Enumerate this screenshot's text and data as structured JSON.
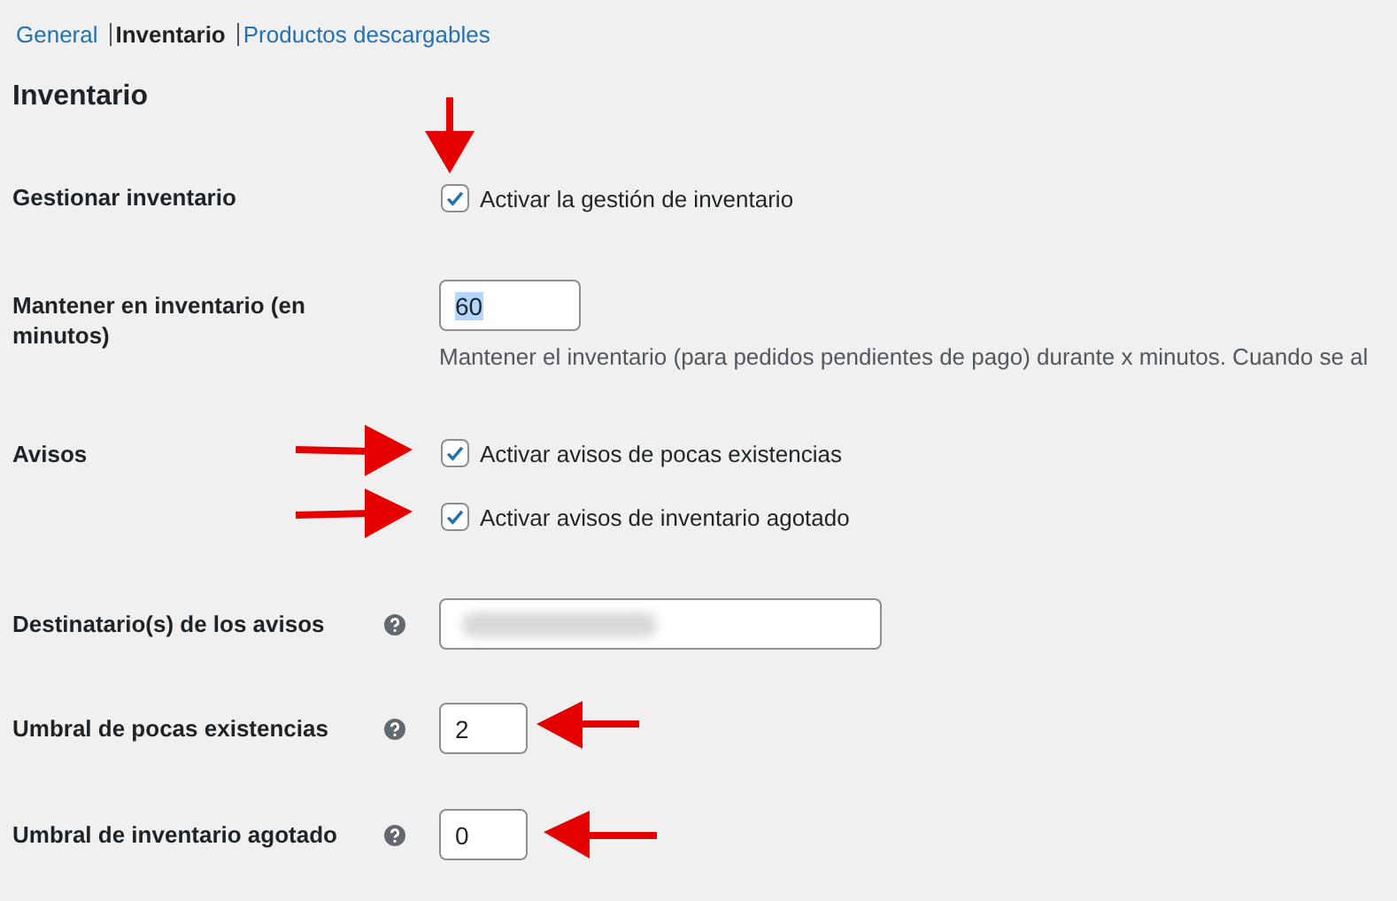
{
  "tabs": [
    {
      "label": "General",
      "selected": false
    },
    {
      "label": "Inventario",
      "selected": true
    },
    {
      "label": "Productos descargables",
      "selected": false
    }
  ],
  "heading": "Inventario",
  "rows": [
    {
      "kind": "checkboxes",
      "label": "Gestionar inventario",
      "help_tip": false,
      "options": [
        {
          "label": "Activar la gestión de inventario",
          "checked": true
        }
      ]
    },
    {
      "kind": "number",
      "label": "Mantener en inventario (en minutos)",
      "help_tip": false,
      "value": "60",
      "value_selected": true,
      "description": "Mantener el inventario (para pedidos pendientes de pago) durante x minutos. Cuando se al"
    },
    {
      "kind": "checkboxes",
      "label": "Avisos",
      "help_tip": false,
      "options": [
        {
          "label": "Activar avisos de pocas existencias",
          "checked": true
        },
        {
          "label": "Activar avisos de inventario agotado",
          "checked": true
        }
      ]
    },
    {
      "kind": "text",
      "label": "Destinatario(s) de los avisos",
      "help_tip": true,
      "blurred": true
    },
    {
      "kind": "number",
      "label": "Umbral de pocas existencias",
      "help_tip": true,
      "value": "2",
      "value_selected": false
    },
    {
      "kind": "number",
      "label": "Umbral de inventario agotado",
      "help_tip": true,
      "value": "0",
      "value_selected": false
    }
  ]
}
